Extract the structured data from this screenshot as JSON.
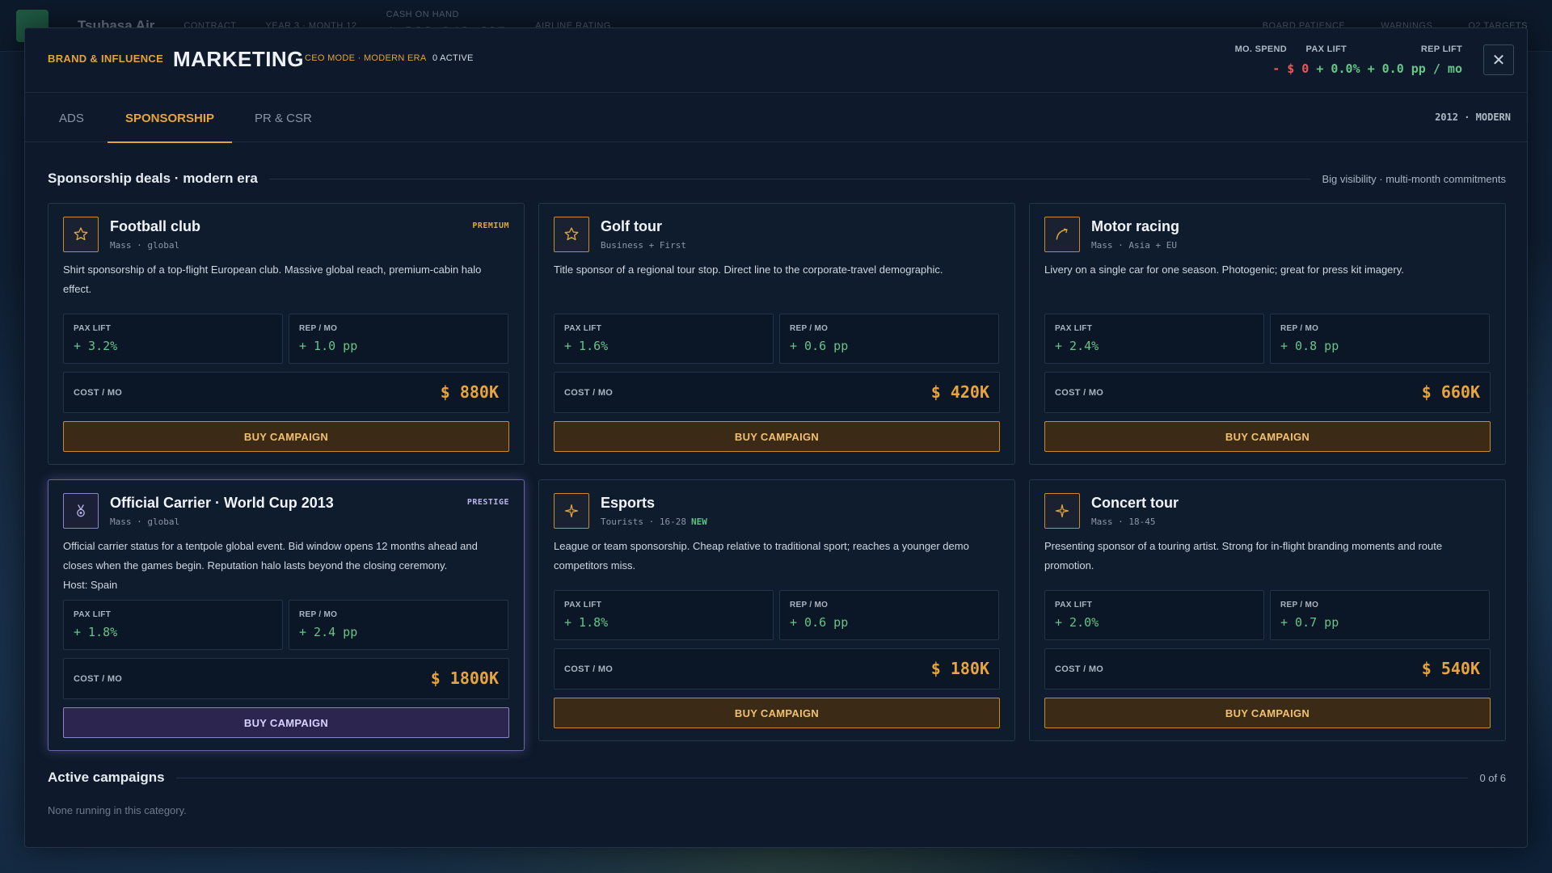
{
  "background": {
    "airline": "Tsubasa Air",
    "contract_label": "CONTRACT",
    "date_label": "YEAR 3 · MONTH 12",
    "cash_label": "CASH ON HAND",
    "cash_value": "$ 388,248,695",
    "rating_label": "AIRLINE RATING",
    "board_label": "BOARD PATIENCE",
    "warnings_label": "WARNINGS",
    "targets_label": "Q2 TARGETS"
  },
  "header": {
    "kicker": "BRAND & INFLUENCE",
    "title": "MARKETING",
    "mode": "CEO MODE · MODERN ERA",
    "active": "0 ACTIVE",
    "labels": {
      "spend": "MO. SPEND",
      "pax": "PAX LIFT",
      "rep": "REP LIFT"
    },
    "values": {
      "spend": "- $ 0",
      "pax": "+ 0.0%",
      "rep": "+ 0.0 pp / mo"
    },
    "close_symbol": "✕"
  },
  "tabs": [
    {
      "label": "ADS",
      "active": false
    },
    {
      "label": "SPONSORSHIP",
      "active": true
    },
    {
      "label": "PR & CSR",
      "active": false
    }
  ],
  "era": "2012 · MODERN",
  "section": {
    "title": "Sponsorship deals · modern era",
    "aside": "Big visibility · multi-month commitments"
  },
  "metric_labels": {
    "pax": "PAX LIFT",
    "rep": "REP / MO",
    "cost": "COST / MO",
    "buy": "BUY CAMPAIGN"
  },
  "cards": [
    {
      "name": "Football club",
      "audience": "Mass · global",
      "badge": "PREMIUM",
      "icon": "star-icon",
      "desc": "Shirt sponsorship of a top-flight European club. Massive global reach, premium-cabin halo effect.",
      "pax": "+ 3.2%",
      "rep": "+ 1.0 pp",
      "cost": "$ 880K"
    },
    {
      "name": "Golf tour",
      "audience": "Business + First",
      "badge": "",
      "icon": "star-icon",
      "desc": "Title sponsor of a regional tour stop. Direct line to the corporate-travel demographic.",
      "pax": "+ 1.6%",
      "rep": "+ 0.6 pp",
      "cost": "$ 420K"
    },
    {
      "name": "Motor racing",
      "audience": "Mass · Asia + EU",
      "badge": "",
      "icon": "gauge-icon",
      "desc": "Livery on a single car for one season. Photogenic; great for press kit imagery.",
      "pax": "+ 2.4%",
      "rep": "+ 0.8 pp",
      "cost": "$ 660K"
    },
    {
      "name": "Official Carrier · World Cup 2013",
      "audience": "Mass · global",
      "badge": "PRESTIGE",
      "icon": "medal-icon",
      "desc": "Official carrier status for a tentpole global event. Bid window opens 12 months ahead and closes when the games begin. Reputation halo lasts beyond the closing ceremony.",
      "host": "Host: Spain",
      "pax": "+ 1.8%",
      "rep": "+ 2.4 pp",
      "cost": "$ 1800K"
    },
    {
      "name": "Esports",
      "audience": "Tourists · 16-28",
      "new_tag": "NEW",
      "badge": "",
      "icon": "sparkle-icon",
      "desc": "League or team sponsorship. Cheap relative to traditional sport; reaches a younger demo competitors miss.",
      "pax": "+ 1.8%",
      "rep": "+ 0.6 pp",
      "cost": "$ 180K"
    },
    {
      "name": "Concert tour",
      "audience": "Mass · 18-45",
      "badge": "",
      "icon": "sparkle-icon",
      "desc": "Presenting sponsor of a touring artist. Strong for in-flight branding moments and route promotion.",
      "pax": "+ 2.0%",
      "rep": "+ 0.7 pp",
      "cost": "$ 540K"
    }
  ],
  "active_section": {
    "title": "Active campaigns",
    "count": "0 of 6",
    "empty": "None running in this category."
  }
}
